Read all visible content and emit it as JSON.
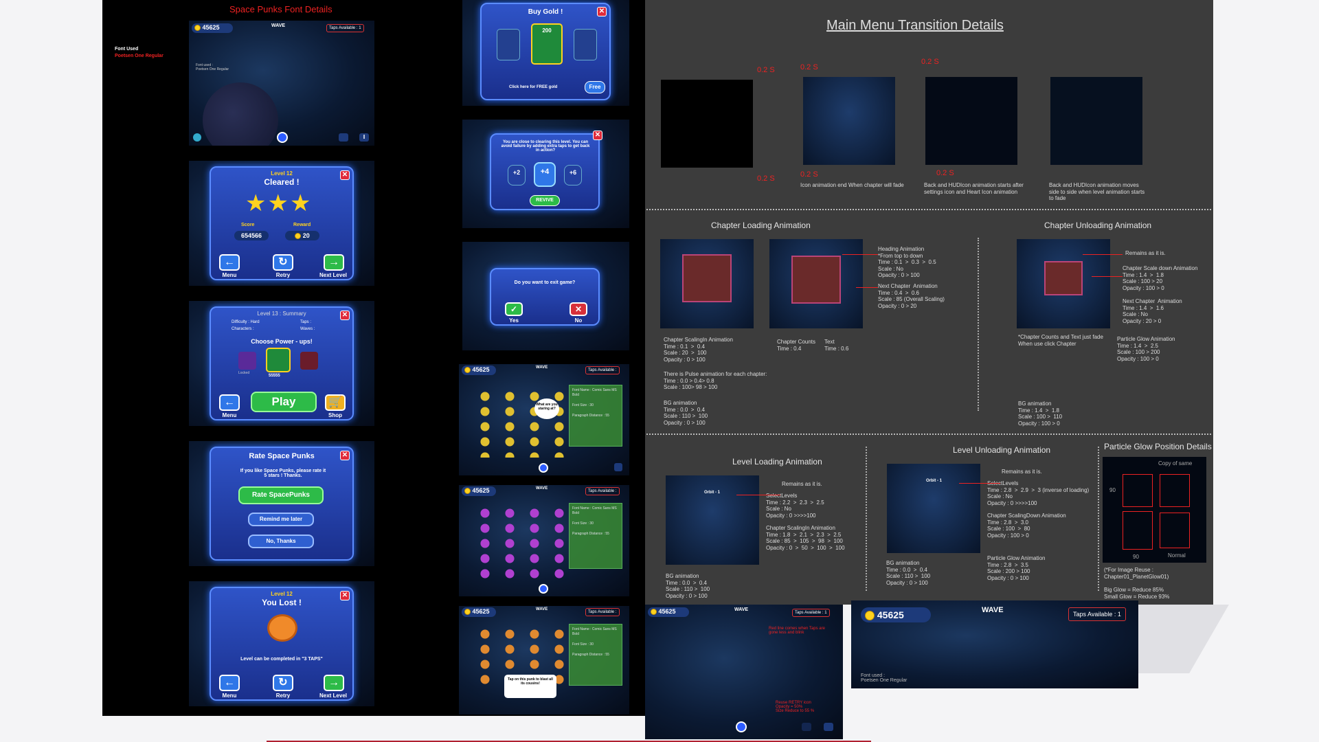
{
  "left": {
    "title": "Space Punks Font Details",
    "font_used_label": "Font Used",
    "font_used_value": "Poetsen One Regular",
    "top_hud": {
      "gold": "45625",
      "wave": "WAVE",
      "taps": "Taps Available :",
      "taps_count": "1"
    },
    "font_used_small": "Font used :",
    "font_used_small_value": "Poetsen One Regular",
    "cleared": {
      "level": "Level 12",
      "title": "Cleared !",
      "score_label": "Score",
      "reward_label": "Reward",
      "score": "654566",
      "reward": "20",
      "menu": "Menu",
      "retry": "Retry",
      "next": "Next Level"
    },
    "summary": {
      "title": "Level 13 : Summary",
      "difficulty": "Difficulty : Hard",
      "taps": "Taps :",
      "characters": "Characters :",
      "waves": "Waves :",
      "choose": "Choose Power - ups!",
      "locked": "Locked",
      "price": "55555",
      "play": "Play",
      "menu": "Menu",
      "shop": "Shop"
    },
    "rate": {
      "title": "Rate Space Punks",
      "text": "If you like Space Punks, please rate it 5 stars ! Thanks.",
      "rate_btn": "Rate SpacePunks",
      "remind": "Remind me later",
      "no": "No, Thanks"
    },
    "lost": {
      "level": "Level 12",
      "title": "You Lost !",
      "text": "Level can be completed in \"3 TAPS\"",
      "menu": "Menu",
      "retry": "Retry",
      "next": "Next Level"
    }
  },
  "middle": {
    "buy": {
      "title": "Buy Gold !",
      "amount": "200",
      "free": "Click here for FREE gold",
      "free_btn": "Free"
    },
    "revive": {
      "text": "You are close to clearing this level. You can avoid failure by adding extra taps to get back in action?",
      "b1": "+2",
      "b2": "+4",
      "b3": "+6",
      "revive": "REVIVE"
    },
    "exit": {
      "text": "Do you want to exit game?",
      "yes": "Yes",
      "no": "No"
    },
    "grid": {
      "gold": "45625",
      "wave": "WAVE",
      "taps": "Taps Available :",
      "bubble": "What are you staring at?",
      "font_name": "Font Name : Comic Sans MS Bold",
      "font_size": "Font Size : 30",
      "para": "Paragraph Distance : 55",
      "tap_note": "Tap on this punk to blast all its cousins!"
    }
  },
  "bottom": {
    "gold": "45625",
    "wave": "WAVE",
    "taps": "Taps Available :",
    "taps_count": "1",
    "note_top": "Red line comes when Taps are gone less and blink",
    "note_retry": "Reuse RETRY icon\nOpacity = 50%\nSize Reduce to 55 %",
    "font_used": "Font used :",
    "font_used_value": "Poetsen One Regular"
  },
  "right": {
    "title": "Main Menu Transition Details",
    "timing": "0.2 S",
    "cap1": "Icon animation end When chapter will fade",
    "cap2": "Back and HUDIcon animation starts after\nsettings icon and Heart Icon animation",
    "cap3": "Back and HUDIcon animation moves\nside to side when level animation starts\nto fade",
    "chapter_loading": "Chapter Loading Animation",
    "chapter_unloading": "Chapter Unloading Animation",
    "cl_scaling": "Chapter ScalingIn Animation\nTime : 0.1  >  0.4\nScale : 20  >  100\nOpacity : 0 > 100",
    "cl_pulse": "There is Pulse animation for each chapter:\nTime : 0.0 > 0.4> 0.8\nScale : 100> 98 > 100",
    "cl_bg": "BG animation\nTime : 0.0  >  0.4\nScale : 110 >  100\nOpacity : 0 > 100",
    "cl_heading": "Heading Animation\n*From top to down\nTime : 0.1  >  0.3  >  0.5\nScale : No\nOpacity : 0 > 100",
    "cl_next": "Next Chapter  Animation\nTime : 0.4  >  0.6\nScale : 85 (Overall Scaling)\nOpacity : 0 > 20",
    "cl_counts": "Chapter Counts\nTime : 0.4",
    "cl_text": "Text\nTime : 0.6",
    "cu_remains": "Remains as it is.",
    "cu_scale": "Chapter Scale down Animation\nTime : 1.4  >  1.8\nScale : 100 > 20\nOpacity : 100 > 0",
    "cu_next": "Next Chapter  Animation\nTime : 1.4  >  1.6\nScale : No\nOpacity : 20 > 0",
    "cu_fade": "*Chapter Counts and Text just fade\nWhen use click Chapter",
    "cu_glow": "Particle Glow Animation\nTime : 1.4  >  2.5\nScale : 100 > 200\nOpacity : 100 > 0",
    "cu_bg": "BG animation\nTime : 1.4  >  1.8\nScale : 100 >  110\nOpacity : 100 > 0",
    "level_loading": "Level Loading Animation",
    "level_unloading": "Level Unloading Animation",
    "particle_title": "Particle Glow Position Details",
    "ll_remains": "Remains as it is.",
    "ll_select": "SelectLevels\nTime : 2.2  >  2.3  >  2.5\nScale : No\nOpacity : 0 >>>>100",
    "ll_scaling": "Chapter ScalingIn Animation\nTime : 1.8  >  2.1  >  2.3  >  2.5\nScale : 85  >  105  >  98  >  100\nOpacity : 0  >  50  >  100  >  100",
    "ll_bg": "BG animation\nTime : 0.0  >  0.4\nScale : 110 >  100\nOpacity : 0 > 100",
    "lu_remains": "Remains as it is.",
    "lu_select": "SelectLevels\nTime : 2.8  >  2.9  >  3 (inverse of loading)\nScale : No\nOpacity : 0 >>>>100",
    "lu_scaling": "Chapter ScalingDown Animation\nTime : 2.8  >  3.0\nScale : 100  >  80\nOpacity : 100 > 0",
    "lu_glow": "Particle Glow Animation\nTime : 2.8  >  3.5\nScale : 200 > 100\nOpacity : 0 > 100",
    "lu_bg": "BG animation\nTime : 0.0  >  0.4\nScale : 110 >  100\nOpacity : 0 > 100",
    "pg_copy": "Copy of same",
    "pg_90": "90",
    "pg_normal": "Normal",
    "pg_reuse": "(*For Image Reuse :\nChapter01_PlanetGlow01)",
    "pg_glow": "Big Glow = Reduce 85%\nSmall Glow = Reduce 93%",
    "orbit": "Orbit - 1"
  }
}
